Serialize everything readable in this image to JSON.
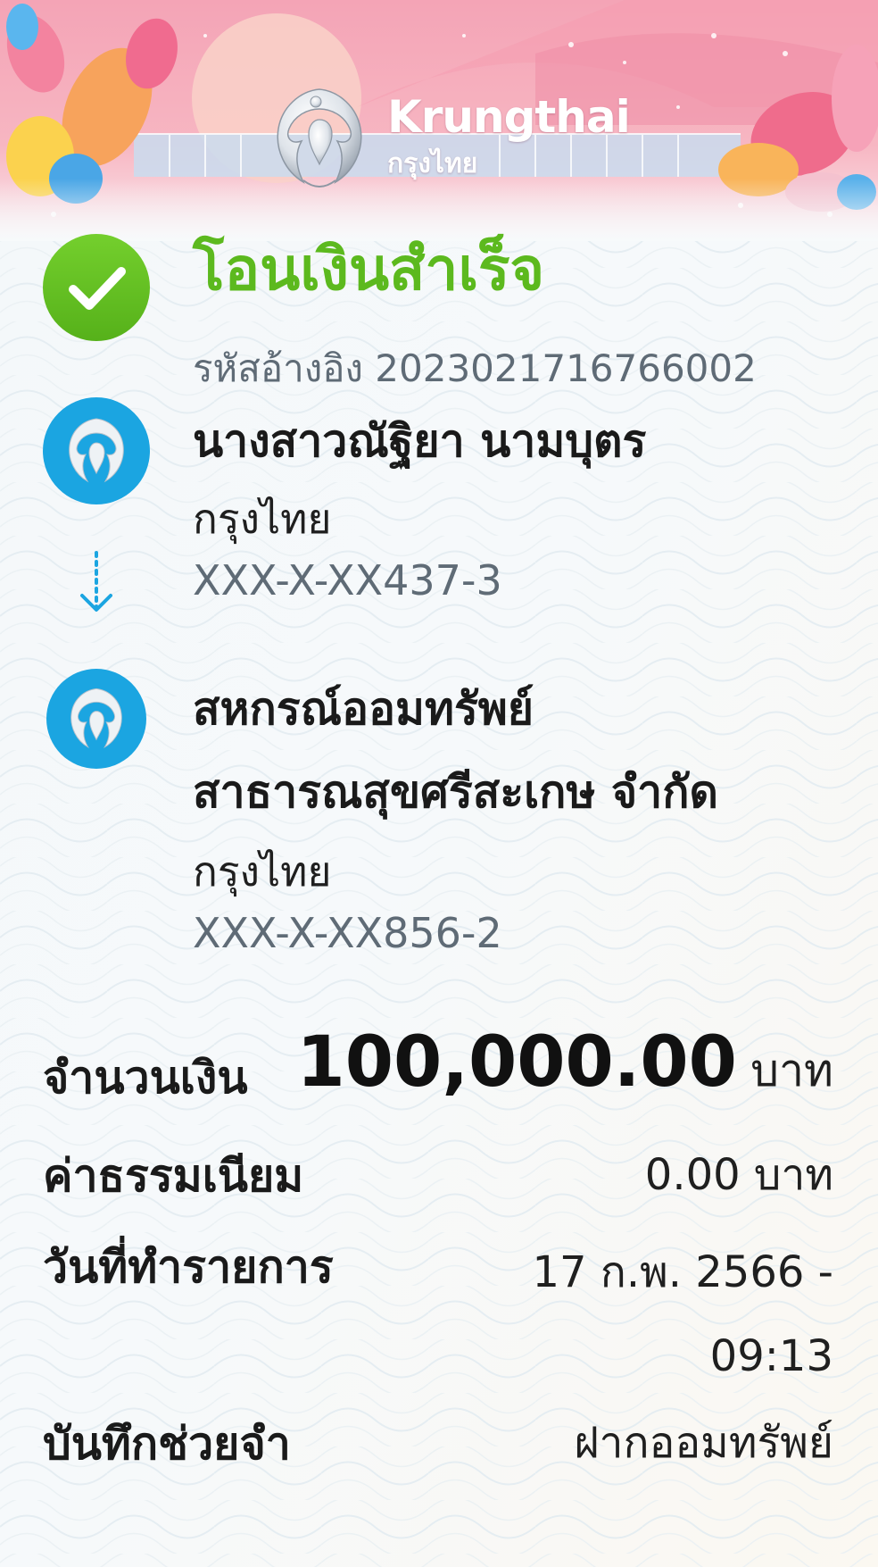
{
  "header": {
    "brand_en": "Krungthai",
    "brand_th": "กรุงไทย"
  },
  "status": {
    "title": "โอนเงินสำเร็จ",
    "reference_label": "รหัสอ้างอิง",
    "reference_value": "2023021716766002"
  },
  "sender": {
    "name": "นางสาวณัฐิยา นามบุตร",
    "bank": "กรุงไทย",
    "account": "XXX-X-XX437-3"
  },
  "receiver": {
    "name_line1": "สหกรณ์ออมทรัพย์",
    "name_line2": "สาธารณสุขศรีสะเกษ จำกัด",
    "bank": "กรุงไทย",
    "account": "XXX-X-XX856-2"
  },
  "details": {
    "amount_label": "จำนวนเงิน",
    "amount_value": "100,000.00",
    "amount_unit": "บาท",
    "fee_label": "ค่าธรรมเนียม",
    "fee_value": "0.00 บาท",
    "date_label": "วันที่ทำรายการ",
    "date_value_line1": "17 ก.พ. 2566 -",
    "date_value_line2": "09:13",
    "memo_label": "บันทึกช่วยจำ",
    "memo_value": "ฝากออมทรัพย์"
  },
  "colors": {
    "success_green": "#5cb91e",
    "bank_blue": "#1ba5e1",
    "muted_text": "#5f6b76"
  },
  "icons": {
    "status": "check-circle-icon",
    "bank_logo": "krungthai-bird-logo",
    "flow": "arrow-down-icon"
  }
}
